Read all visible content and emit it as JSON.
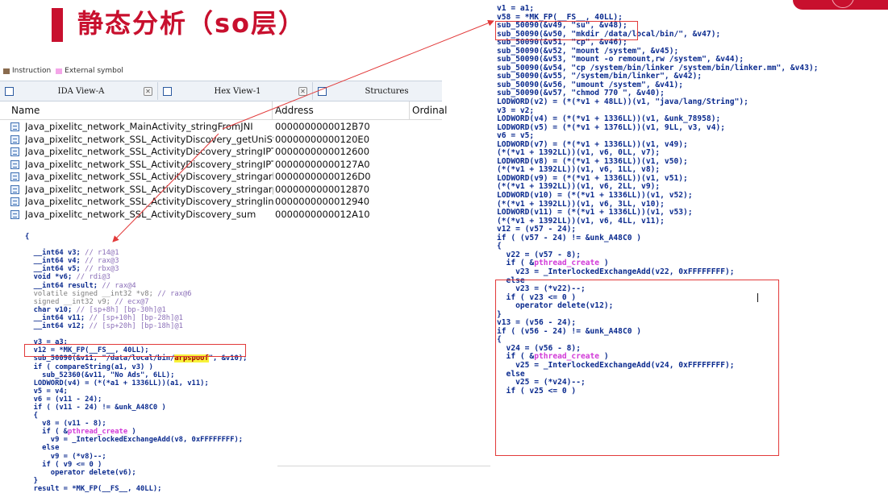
{
  "slide": {
    "title": "静态分析（so层）",
    "accent_color": "#c8102e"
  },
  "ida": {
    "legend": [
      "Instruction",
      "External symbol"
    ],
    "tabs": [
      {
        "label": "IDA View-A",
        "icon": "ida-view-icon"
      },
      {
        "label": "Hex View-1",
        "icon": "hex-view-icon"
      },
      {
        "label": "Structures",
        "icon": "structures-icon"
      }
    ],
    "columns": {
      "name": "Name",
      "address": "Address",
      "ordinal": "Ordinal"
    },
    "exports": [
      {
        "name": "Java_pixelitc_network_MainActivity_stringFromJNI",
        "address": "0000000000012B70"
      },
      {
        "name": "Java_pixelitc_network_SSL_ActivityDiscovery_getUniString",
        "address": "00000000000120E0"
      },
      {
        "name": "Java_pixelitc_network_SSL_ActivityDiscovery_stringIPTable",
        "address": "0000000000012600"
      },
      {
        "name": "Java_pixelitc_network_SSL_ActivityDiscovery_stringIPTableR...",
        "address": "00000000000127A0"
      },
      {
        "name": "Java_pixelitc_network_SSL_ActivityDiscovery_stringarbPath",
        "address": "00000000000126D0"
      },
      {
        "name": "Java_pixelitc_network_SSL_ActivityDiscovery_stringarpspoof",
        "address": "0000000000012870"
      },
      {
        "name": "Java_pixelitc_network_SSL_ActivityDiscovery_stringlinker",
        "address": "0000000000012940"
      },
      {
        "name": "Java_pixelitc_network_SSL_ActivityDiscovery_sum",
        "address": "0000000000012A10"
      }
    ]
  },
  "code_left": {
    "open_brace": "{",
    "decls": [
      {
        "code": "  __int64 v3; ",
        "comment": "// r14@1"
      },
      {
        "code": "  __int64 v4; ",
        "comment": "// rax@3"
      },
      {
        "code": "  __int64 v5; ",
        "comment": "// rbx@3"
      },
      {
        "code": "  void *v6; ",
        "comment": "// rdi@3"
      },
      {
        "code": "  __int64 result; ",
        "comment": "// rax@4"
      },
      {
        "code": "  volatile signed __int32 *v8; ",
        "comment": "// rax@6",
        "dim": true
      },
      {
        "code": "  signed __int32 v9; ",
        "comment": "// ecx@7",
        "dim": true
      },
      {
        "code": "  char v10; ",
        "comment": "// [sp+8h] [bp-30h]@1"
      },
      {
        "code": "  __int64 v11; ",
        "comment": "// [sp+10h] [bp-28h]@1"
      },
      {
        "code": "  __int64 v12; ",
        "comment": "// [sp+20h] [bp-18h]@1"
      }
    ],
    "l1": "  v3 = a3;",
    "l2": "  v12 = *MK_FP(__FS__, 40LL);",
    "sub_pre": "  sub_50090(&v11, \"/data/local/bin/",
    "sub_hl": "arpspoof",
    "sub_post": "\", &v10);",
    "if1_pre": "  if ( ",
    "if1_fn": "compareString(a1, v3) )",
    "l3": "    sub_52360(&v11, \"No Ads\", 6LL);",
    "l4": "  LODWORD(v4) = (*(*a1 + 1336LL))(a1, v11);",
    "l5": "  v5 = v4;",
    "l6": "  v6 = (v11 - 24);",
    "l7": "  if ( (v11 - 24) != &unk_A48C0 )",
    "l8": "  {",
    "l9": "    v8 = (v11 - 8);",
    "if2_pre": "    if ( &",
    "if2_pk": "pthread_create",
    "if2_post": " )",
    "l10": "      v9 = _InterlockedExchangeAdd(v8, 0xFFFFFFFF);",
    "l11": "    else",
    "l12": "      v9 = (*v8)--;",
    "l13": "    if ( v9 <= 0 )",
    "l14": "      operator delete(v6);",
    "l15": "  }",
    "l16": "  result = *MK_FP(__FS__, 40LL);"
  },
  "code_right": {
    "lines_top": [
      "v1 = a1;",
      "v58 = *MK_FP(__FS__, 40LL);",
      "sub_50090(&v49, \"su\", &v48);",
      "sub_50090(&v50, \"mkdir /data/local/bin/\", &v47);",
      "sub_50090(&v51, \"cp\", &v46);",
      "sub_50090(&v52, \"mount /system\", &v45);",
      "sub_50090(&v53, \"mount -o remount,rw /system\", &v44);",
      "sub_50090(&v54, \"cp /system/bin/linker /system/bin/linker.mm\", &v43);",
      "sub_50090(&v55, \"/system/bin/linker\", &v42);",
      "sub_50090(&v56, \"umount /system\", &v41);",
      "sub_50090(&v57, \"chmod 770 \", &v40);",
      "LODWORD(v2) = (*(*v1 + 48LL))(v1, \"java/lang/String\");",
      "v3 = v2;",
      "LODWORD(v4) = (*(*v1 + 1336LL))(v1, &unk_78958);",
      "LODWORD(v5) = (*(*v1 + 1376LL))(v1, 9LL, v3, v4);",
      "v6 = v5;",
      "LODWORD(v7) = (*(*v1 + 1336LL))(v1, v49);",
      "(*(*v1 + 1392LL))(v1, v6, 0LL, v7);",
      "LODWORD(v8) = (*(*v1 + 1336LL))(v1, v50);",
      "(*(*v1 + 1392LL))(v1, v6, 1LL, v8);",
      "LODWORD(v9) = (*(*v1 + 1336LL))(v1, v51);",
      "(*(*v1 + 1392LL))(v1, v6, 2LL, v9);",
      "LODWORD(v10) = (*(*v1 + 1336LL))(v1, v52);",
      "(*(*v1 + 1392LL))(v1, v6, 3LL, v10);",
      "LODWORD(v11) = (*(*v1 + 1336LL))(v1, v53);",
      "(*(*v1 + 1392LL))(v1, v6, 4LL, v11);",
      "v12 = (v57 - 24);",
      "if ( (v57 - 24) != &unk_A48C0 )",
      "{",
      "  v22 = (v57 - 8);"
    ],
    "if_a_pre": "  if ( &",
    "if_a_pk": "pthread_create",
    "if_a_post": " )",
    "lines_mid": [
      "    v23 = _InterlockedExchangeAdd(v22, 0xFFFFFFFF);",
      "  else",
      "    v23 = (*v22)--;",
      "  if ( v23 <= 0 )",
      "    operator delete(v12);",
      "}",
      "v13 = (v56 - 24);",
      "if ( (v56 - 24) != &unk_A48C0 )",
      "{",
      "  v24 = (v56 - 8);"
    ],
    "if_b_pre": "  if ( &",
    "if_b_pk": "pthread_create",
    "if_b_post": " )",
    "lines_end": [
      "    v25 = _InterlockedExchangeAdd(v24, 0xFFFFFFFF);",
      "  else",
      "    v25 = (*v24)--;",
      "  if ( v25 <= 0 )"
    ]
  }
}
